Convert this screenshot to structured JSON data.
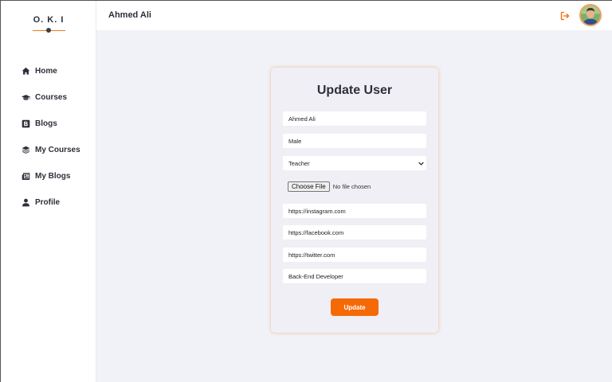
{
  "app": {
    "logo": "O. K. I",
    "accent": "#f56a07"
  },
  "header": {
    "user_name": "Ahmed Ali"
  },
  "sidebar": {
    "items": [
      {
        "label": "Home",
        "icon": "home-icon"
      },
      {
        "label": "Courses",
        "icon": "graduation-cap-icon"
      },
      {
        "label": "Blogs",
        "icon": "blog-icon"
      },
      {
        "label": "My Courses",
        "icon": "layers-icon"
      },
      {
        "label": "My Blogs",
        "icon": "newspaper-icon"
      },
      {
        "label": "Profile",
        "icon": "user-icon"
      }
    ]
  },
  "form": {
    "title": "Update User",
    "name": "Ahmed Ali",
    "gender": "Male",
    "role": "Teacher",
    "file_button": "Choose File",
    "file_status": "No file chosen",
    "instagram": "https://instagram.com",
    "facebook": "https://facebook.com",
    "twitter": "https://twitter.com",
    "bio": "Back-End Developer",
    "submit_label": "Update"
  }
}
